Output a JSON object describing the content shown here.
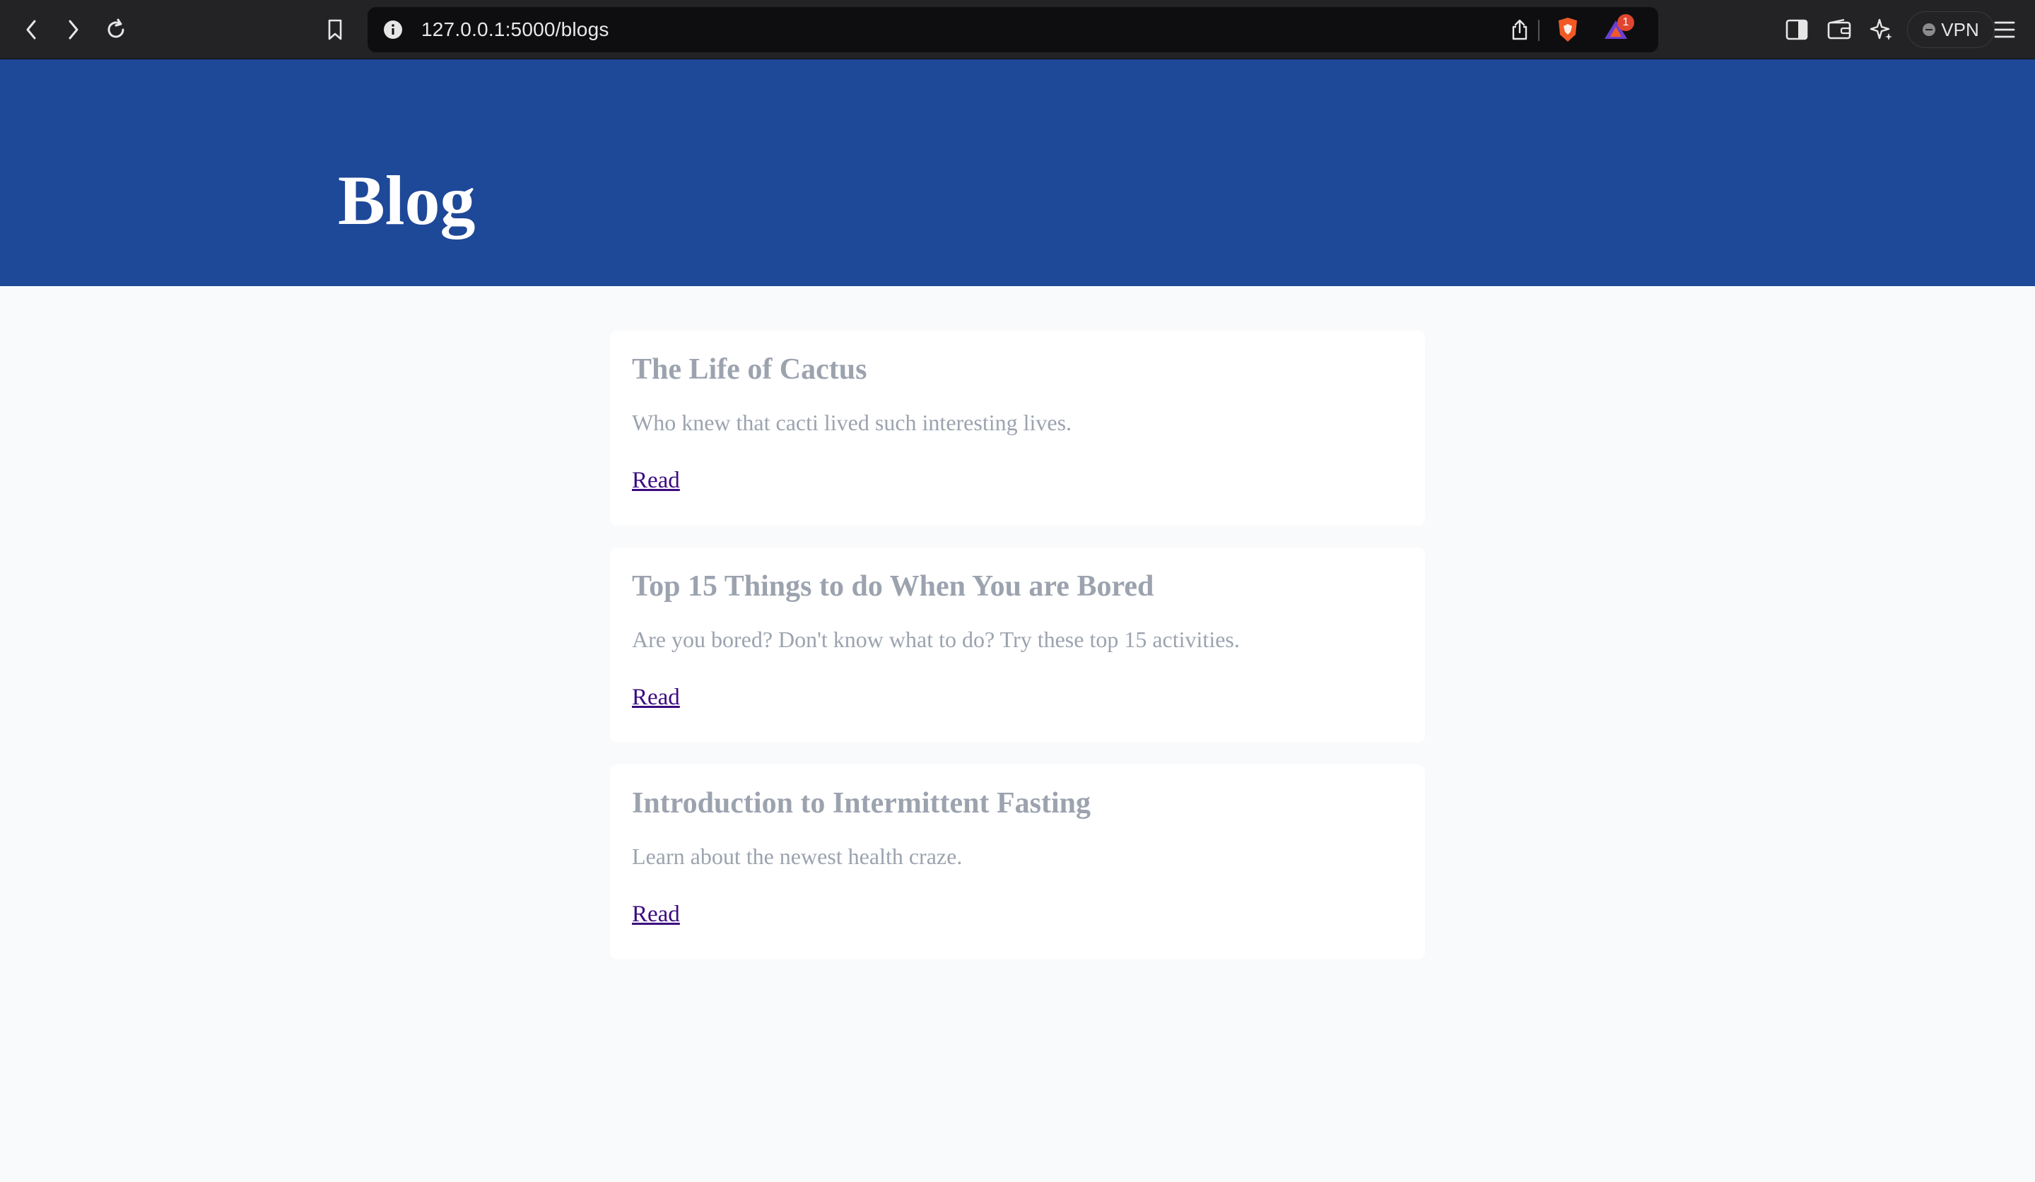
{
  "browser": {
    "url": "127.0.0.1:5000/blogs",
    "vpn_label": "VPN",
    "notification_count": "1",
    "icons": [
      "back-icon",
      "forward-icon",
      "reload-icon",
      "bookmark-icon",
      "site-info-icon",
      "share-icon",
      "brave-shields-icon",
      "brave-rewards-icon",
      "sidebar-icon",
      "wallet-icon",
      "leo-ai-icon",
      "vpn-icon",
      "menu-icon"
    ]
  },
  "header": {
    "title": "Blog",
    "background_color": "#1e4898"
  },
  "posts": [
    {
      "title": "The Life of Cactus",
      "summary": "Who knew that cacti lived such interesting lives.",
      "link_label": "Read"
    },
    {
      "title": "Top 15 Things to do When You are Bored",
      "summary": "Are you bored? Don't know what to do? Try these top 15 activities.",
      "link_label": "Read"
    },
    {
      "title": "Introduction to Intermittent Fasting",
      "summary": "Learn about the newest health craze.",
      "link_label": "Read"
    }
  ],
  "colors": {
    "page_background": "#f9fafb",
    "card_text": "#9ca3af",
    "link": "#3b0a7f"
  }
}
